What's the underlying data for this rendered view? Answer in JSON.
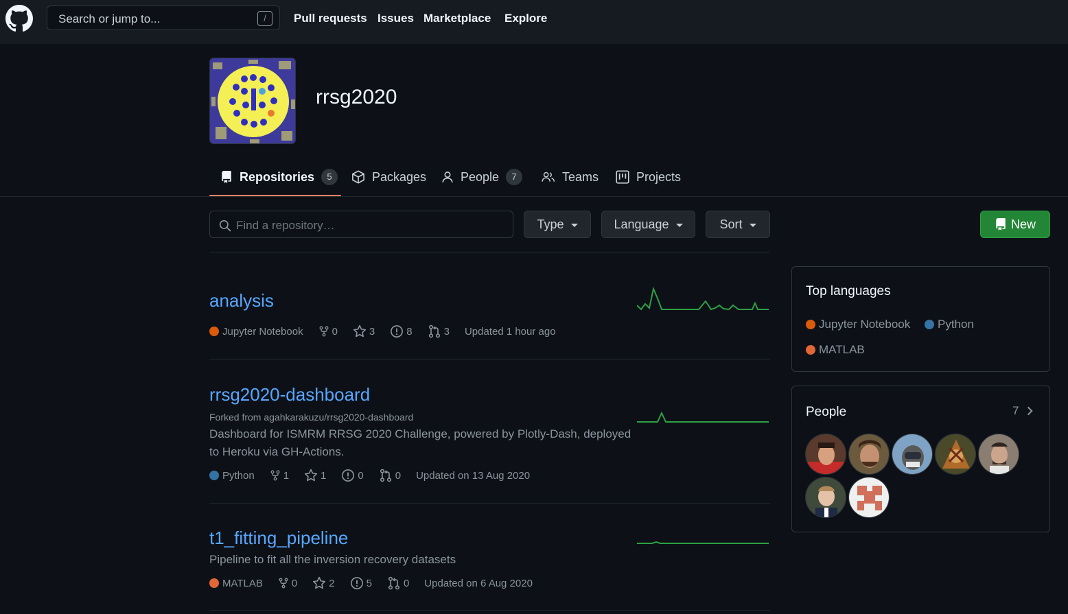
{
  "header": {
    "search_placeholder": "Search or jump to...",
    "search_shortcut": "/",
    "nav": [
      "Pull requests",
      "Issues",
      "Marketplace",
      "Explore"
    ]
  },
  "org": {
    "name": "rrsg2020"
  },
  "tabs": [
    {
      "label": "Repositories",
      "count": "5",
      "icon": "repo-icon",
      "selected": true
    },
    {
      "label": "Packages",
      "icon": "package-icon"
    },
    {
      "label": "People",
      "count": "7",
      "icon": "person-icon"
    },
    {
      "label": "Teams",
      "icon": "people-icon"
    },
    {
      "label": "Projects",
      "icon": "project-icon"
    }
  ],
  "filters": {
    "find_placeholder": "Find a repository…",
    "type": "Type",
    "language": "Language",
    "sort": "Sort",
    "new": "New"
  },
  "repos": [
    {
      "name": "analysis",
      "language": "Jupyter Notebook",
      "lang_color": "#da5b0b",
      "forks": "0",
      "stars": "3",
      "issues": "8",
      "prs": "3",
      "updated": "Updated 1 hour ago"
    },
    {
      "name": "rrsg2020-dashboard",
      "forked_from": "Forked from agahkarakuzu/rrsg2020-dashboard",
      "description": "Dashboard for ISMRM RRSG 2020 Challenge, powered by Plotly-Dash, deployed to Heroku via GH-Actions.",
      "language": "Python",
      "lang_color": "#3572a5",
      "forks": "1",
      "stars": "1",
      "issues": "0",
      "prs": "0",
      "updated": "Updated on 13 Aug 2020"
    },
    {
      "name": "t1_fitting_pipeline",
      "description": "Pipeline to fit all the inversion recovery datasets",
      "language": "MATLAB",
      "lang_color": "#e16737",
      "forks": "0",
      "stars": "2",
      "issues": "5",
      "prs": "0",
      "updated": "Updated on 6 Aug 2020"
    }
  ],
  "sidebar": {
    "top_languages_title": "Top languages",
    "languages": [
      {
        "name": "Jupyter Notebook",
        "color": "#da5b0b"
      },
      {
        "name": "Python",
        "color": "#3572a5"
      },
      {
        "name": "MATLAB",
        "color": "#e16737"
      }
    ],
    "people_title": "People",
    "people_count": "7"
  },
  "colors": {
    "accent": "#58a6ff",
    "tab_underline": "#f78166",
    "new_button": "#238636",
    "spark": "#2ea043"
  }
}
